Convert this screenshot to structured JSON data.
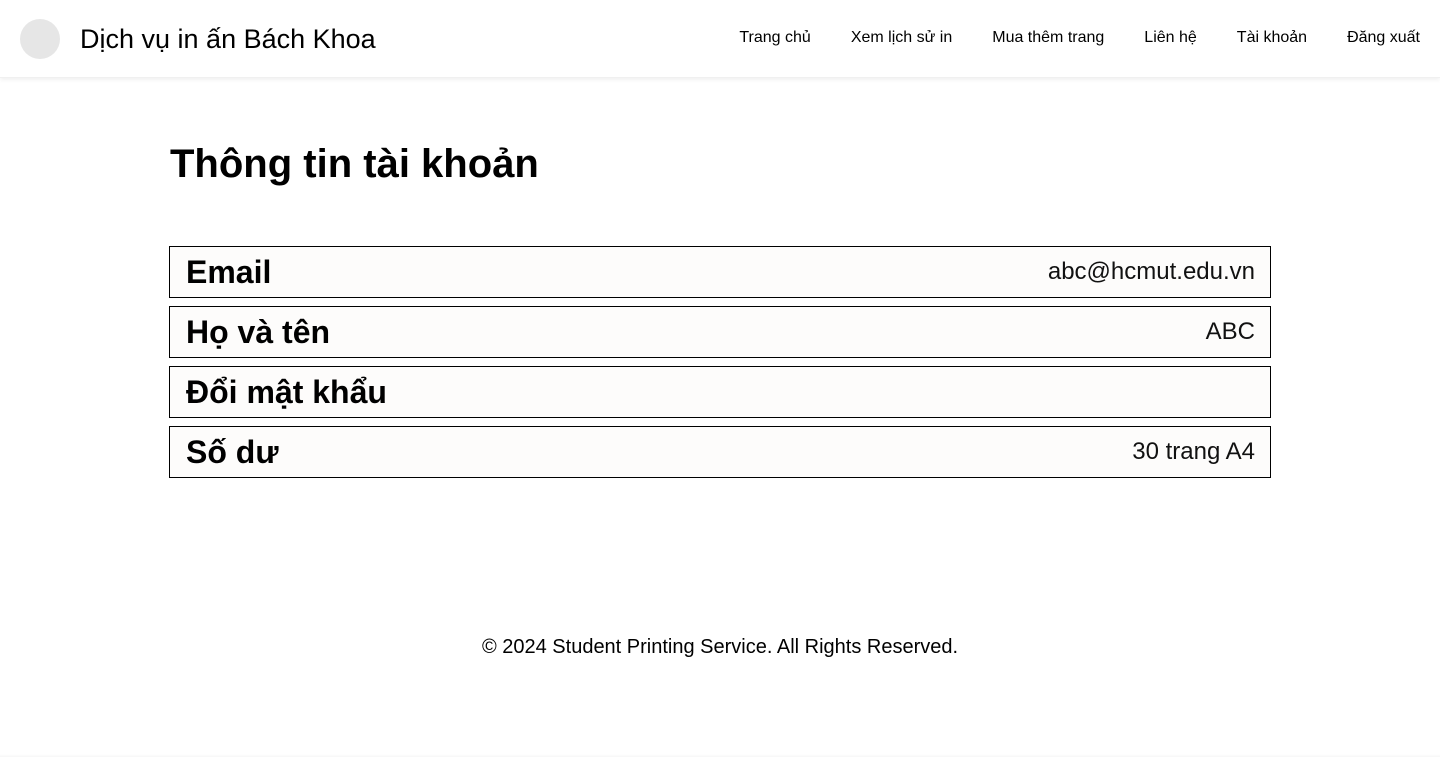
{
  "header": {
    "brand": "Dịch vụ in ấn Bách Khoa",
    "logo_icon": "logo-placeholder-icon",
    "nav": [
      {
        "label": "Trang chủ"
      },
      {
        "label": "Xem lịch sử in"
      },
      {
        "label": "Mua thêm trang"
      },
      {
        "label": "Liên hệ"
      },
      {
        "label": "Tài khoản"
      },
      {
        "label": "Đăng xuất"
      }
    ]
  },
  "main": {
    "title": "Thông tin tài khoản",
    "rows": [
      {
        "label": "Email",
        "value": "abc@hcmut.edu.vn"
      },
      {
        "label": "Họ và tên",
        "value": "ABC"
      },
      {
        "label": "Đổi mật khẩu",
        "value": ""
      },
      {
        "label": "Số dư",
        "value": "30 trang A4"
      }
    ]
  },
  "footer": {
    "text": "© 2024 Student Printing Service. All Rights Reserved."
  },
  "colors": {
    "row_background": "#fdfcfb",
    "row_border": "#000000",
    "logo_placeholder": "#e6e6e6"
  }
}
